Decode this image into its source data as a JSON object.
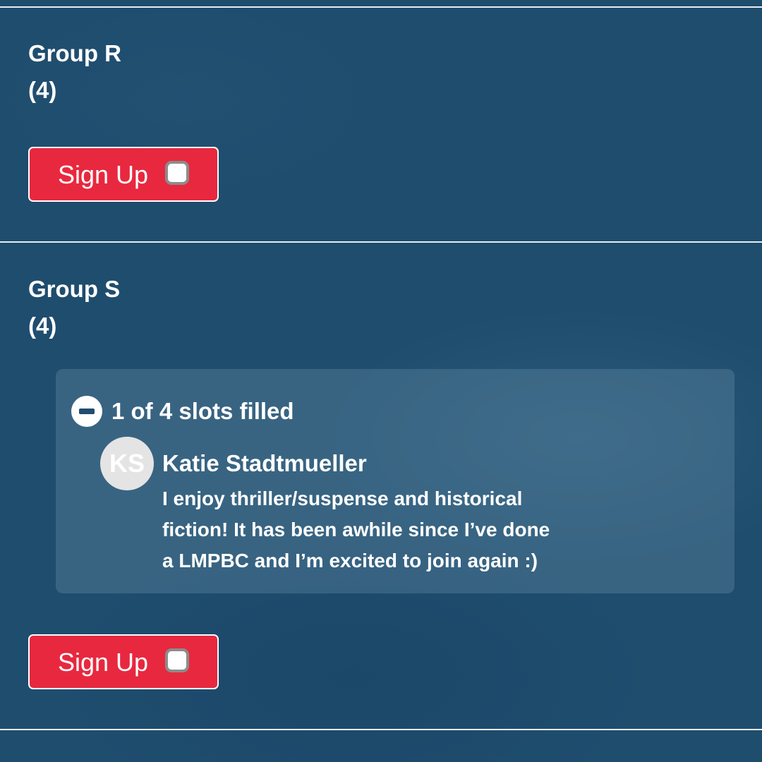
{
  "groups": [
    {
      "title": "Group R",
      "count": "(4)",
      "signup_label": "Sign Up"
    },
    {
      "title": "Group S",
      "count": "(4)",
      "slots": {
        "summary": "1 of 4 slots filled",
        "members": [
          {
            "initials": "KS",
            "name": "Katie Stadtmueller",
            "comment_lines": [
              "I enjoy thriller/suspense and historical",
              "fiction! It has been awhile since I’ve done",
              "a LMPBC and I’m excited to join again :)"
            ]
          }
        ]
      },
      "signup_label": "Sign Up"
    }
  ],
  "colors": {
    "background": "#1f4d6e",
    "signup_button": "#e8283f",
    "divider": "#e7edf2"
  },
  "icons": {
    "collapse": "minus-circle-icon",
    "signup_checkbox": "checkbox-icon"
  }
}
